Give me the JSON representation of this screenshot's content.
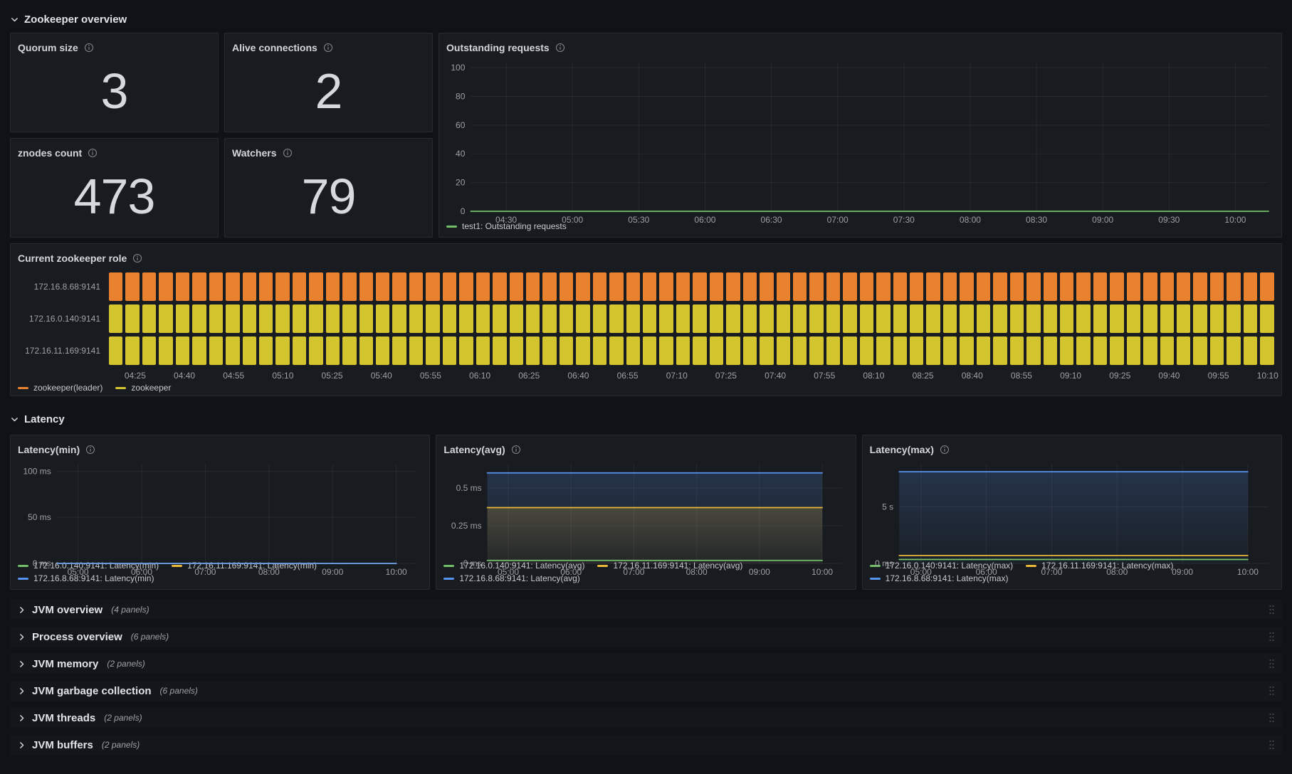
{
  "sections": [
    {
      "id": "zookeeper-overview",
      "title": "Zookeeper overview",
      "collapsed": false
    },
    {
      "id": "latency",
      "title": "Latency",
      "collapsed": false
    }
  ],
  "stat_panels": [
    {
      "title": "Quorum size",
      "value": "3"
    },
    {
      "title": "Alive connections",
      "value": "2"
    },
    {
      "title": "znodes count",
      "value": "473"
    },
    {
      "title": "Watchers",
      "value": "79"
    }
  ],
  "collapsed_rows": [
    {
      "title": "JVM overview",
      "count": "(4 panels)"
    },
    {
      "title": "Process overview",
      "count": "(6 panels)"
    },
    {
      "title": "JVM memory",
      "count": "(2 panels)"
    },
    {
      "title": "JVM garbage collection",
      "count": "(6 panels)"
    },
    {
      "title": "JVM threads",
      "count": "(2 panels)"
    },
    {
      "title": "JVM buffers",
      "count": "(2 panels)"
    }
  ],
  "chart_data": [
    {
      "id": "outstanding-requests",
      "type": "line",
      "title": "Outstanding requests",
      "x_axis": {
        "range": [
          "04:14",
          "10:15"
        ],
        "ticks": [
          "04:30",
          "05:00",
          "05:30",
          "06:00",
          "06:30",
          "07:00",
          "07:30",
          "08:00",
          "08:30",
          "09:00",
          "09:30",
          "10:00"
        ]
      },
      "y_axis": {
        "range": [
          0,
          104
        ],
        "ticks": [
          {
            "v": 0,
            "label": "0"
          },
          {
            "v": 20,
            "label": "20"
          },
          {
            "v": 40,
            "label": "40"
          },
          {
            "v": 60,
            "label": "60"
          },
          {
            "v": 80,
            "label": "80"
          },
          {
            "v": 100,
            "label": "100"
          }
        ]
      },
      "grid": true,
      "series": [
        {
          "name": "test1: Outstanding requests",
          "color": "#73BF69",
          "x_span": [
            "04:14",
            "10:15"
          ],
          "value": 0,
          "fill": false
        }
      ],
      "legend": [
        {
          "label": "test1: Outstanding requests",
          "color": "#73BF69"
        }
      ]
    },
    {
      "id": "latency-min",
      "type": "line",
      "title": "Latency(min)",
      "x_axis": {
        "range": [
          "04:40",
          "10:19"
        ],
        "ticks": [
          "05:00",
          "06:00",
          "07:00",
          "08:00",
          "09:00",
          "10:00"
        ]
      },
      "y_axis": {
        "range": [
          0,
          108
        ],
        "ticks": [
          {
            "v": 0,
            "label": "0 ms"
          },
          {
            "v": 50,
            "label": "50 ms"
          },
          {
            "v": 100,
            "label": "100 ms"
          }
        ]
      },
      "grid": true,
      "series": [
        {
          "name": "172.16.0.140:9141: Latency(min)",
          "color": "#73BF69",
          "x_span": [
            "04:40",
            "10:00"
          ],
          "value": 0,
          "fill": false
        },
        {
          "name": "172.16.11.169:9141: Latency(min)",
          "color": "#EAB839",
          "x_span": [
            "04:40",
            "10:00"
          ],
          "value": 0,
          "fill": false
        },
        {
          "name": "172.16.8.68:9141: Latency(min)",
          "color": "#5794F2",
          "x_span": [
            "04:40",
            "10:00"
          ],
          "value": 0,
          "fill": false
        }
      ],
      "legend": [
        {
          "label": "172.16.0.140:9141: Latency(min)",
          "color": "#73BF69"
        },
        {
          "label": "172.16.11.169:9141: Latency(min)",
          "color": "#EAB839"
        },
        {
          "label": "172.16.8.68:9141: Latency(min)",
          "color": "#5794F2"
        }
      ]
    },
    {
      "id": "latency-avg",
      "type": "line",
      "title": "Latency(avg)",
      "x_axis": {
        "range": [
          "04:40",
          "10:19"
        ],
        "ticks": [
          "05:00",
          "06:00",
          "07:00",
          "08:00",
          "09:00",
          "10:00"
        ]
      },
      "y_axis": {
        "range": [
          0,
          0.66
        ],
        "ticks": [
          {
            "v": 0,
            "label": "0 ms"
          },
          {
            "v": 0.25,
            "label": "0.25 ms"
          },
          {
            "v": 0.5,
            "label": "0.5 ms"
          }
        ]
      },
      "grid": true,
      "series": [
        {
          "name": "172.16.8.68:9141: Latency(avg)",
          "color": "#5794F2",
          "x_span": [
            "04:40",
            "10:00"
          ],
          "value": 0.6,
          "fill": true
        },
        {
          "name": "172.16.11.169:9141: Latency(avg)",
          "color": "#EAB839",
          "x_span": [
            "04:40",
            "10:00"
          ],
          "value": 0.37,
          "fill": true
        },
        {
          "name": "172.16.0.140:9141: Latency(avg)",
          "color": "#73BF69",
          "x_span": [
            "04:40",
            "10:00"
          ],
          "value": 0.02,
          "fill": false
        }
      ],
      "legend": [
        {
          "label": "172.16.0.140:9141: Latency(avg)",
          "color": "#73BF69"
        },
        {
          "label": "172.16.11.169:9141: Latency(avg)",
          "color": "#EAB839"
        },
        {
          "label": "172.16.8.68:9141: Latency(avg)",
          "color": "#5794F2"
        }
      ]
    },
    {
      "id": "latency-max",
      "type": "line",
      "title": "Latency(max)",
      "x_axis": {
        "range": [
          "04:40",
          "10:19"
        ],
        "ticks": [
          "05:00",
          "06:00",
          "07:00",
          "08:00",
          "09:00",
          "10:00"
        ]
      },
      "y_axis": {
        "range": [
          0,
          8.8
        ],
        "ticks": [
          {
            "v": 0,
            "label": "0 ms"
          },
          {
            "v": 5,
            "label": "5 s"
          }
        ]
      },
      "grid": true,
      "series": [
        {
          "name": "172.16.8.68:9141: Latency(max)",
          "color": "#5794F2",
          "x_span": [
            "04:40",
            "10:00"
          ],
          "value": 8.1,
          "fill": true
        },
        {
          "name": "172.16.11.169:9141: Latency(max)",
          "color": "#EAB839",
          "x_span": [
            "04:40",
            "10:00"
          ],
          "value": 0.7,
          "fill": false
        },
        {
          "name": "172.16.0.140:9141: Latency(max)",
          "color": "#73BF69",
          "x_span": [
            "04:40",
            "10:00"
          ],
          "value": 0.35,
          "fill": false
        }
      ],
      "legend": [
        {
          "label": "172.16.0.140:9141: Latency(max)",
          "color": "#73BF69"
        },
        {
          "label": "172.16.11.169:9141: Latency(max)",
          "color": "#EAB839"
        },
        {
          "label": "172.16.8.68:9141: Latency(max)",
          "color": "#5794F2"
        }
      ]
    },
    {
      "id": "zookeeper-role",
      "type": "state-timeline",
      "title": "Current zookeeper role",
      "x_axis": {
        "range": [
          "04:17",
          "10:12"
        ],
        "ticks": [
          "04:25",
          "04:40",
          "04:55",
          "05:10",
          "05:25",
          "05:40",
          "05:55",
          "06:10",
          "06:25",
          "06:40",
          "06:55",
          "07:10",
          "07:25",
          "07:40",
          "07:55",
          "08:10",
          "08:25",
          "08:40",
          "08:55",
          "09:10",
          "09:25",
          "09:40",
          "09:55",
          "10:10"
        ]
      },
      "block_count": 70,
      "rows": [
        {
          "label": "172.16.8.68:9141",
          "state": "zookeeper(leader)",
          "color": "#E8822E",
          "span": [
            "04:17",
            "10:12"
          ]
        },
        {
          "label": "172.16.0.140:9141",
          "state": "zookeeper",
          "color": "#D4C42E",
          "span": [
            "04:17",
            "10:12"
          ]
        },
        {
          "label": "172.16.11.169:9141",
          "state": "zookeeper",
          "color": "#D4C42E",
          "span": [
            "04:17",
            "10:12"
          ]
        }
      ],
      "legend": [
        {
          "label": "zookeeper(leader)",
          "color": "#E8822E"
        },
        {
          "label": "zookeeper",
          "color": "#D4C42E"
        }
      ]
    }
  ]
}
